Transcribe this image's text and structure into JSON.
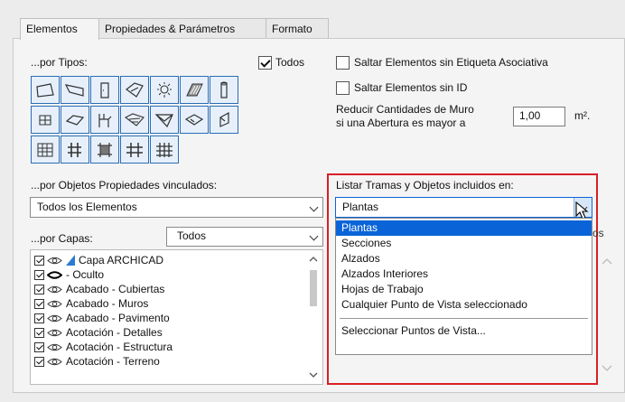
{
  "tabs": [
    "Elementos",
    "Propiedades & Parámetros",
    "Formato"
  ],
  "by_type": {
    "label": "...por Tipos:",
    "all_label": "Todos",
    "icons": [
      [
        "wall-icon",
        "beam-icon",
        "door-icon",
        "window-icon",
        "lamp-icon",
        "slab-hatch-icon",
        "column-icon"
      ],
      [
        "object-icon",
        "slab-icon",
        "stair-icon",
        "roof-icon",
        "shell-icon",
        "morph-icon",
        "curtain-wall-icon"
      ],
      [
        "mesh-icon",
        "railing-icon",
        "zone-icon",
        "grid-icon",
        "fill-icon"
      ]
    ]
  },
  "options": {
    "skip_no_label": "Saltar Elementos sin Etiqueta Asociativa",
    "skip_no_id": "Saltar Elementos sin ID",
    "reduce_label_1": "Reducir Cantidades de Muro",
    "reduce_label_2": "si una Abertura es mayor a",
    "reduce_value": "1,00",
    "reduce_unit": "m²."
  },
  "by_props": {
    "label": "...por Objetos Propiedades vinculados:",
    "value": "Todos los Elementos"
  },
  "by_layers": {
    "label": "...por Capas:",
    "value": "Todos",
    "items": [
      {
        "name": "Capa ARCHICAD",
        "hidden": false,
        "special": true
      },
      {
        "name": "- Oculto",
        "hidden": true,
        "special": false
      },
      {
        "name": "Acabado - Cubiertas",
        "hidden": false,
        "special": false
      },
      {
        "name": "Acabado - Muros",
        "hidden": false,
        "special": false
      },
      {
        "name": "Acabado - Pavimento",
        "hidden": false,
        "special": false
      },
      {
        "name": "Acotación - Detalles",
        "hidden": false,
        "special": false
      },
      {
        "name": "Acotación - Estructura",
        "hidden": false,
        "special": false
      },
      {
        "name": "Acotación - Terreno",
        "hidden": false,
        "special": false
      }
    ]
  },
  "list_in": {
    "label": "Listar Tramas y Objetos incluidos en:",
    "value": "Plantas",
    "options": [
      "Plantas",
      "Secciones",
      "Alzados",
      "Alzados Interiores",
      "Hojas de Trabajo",
      "Cualquier Punto de Vista seleccionado"
    ],
    "extra_option": "Seleccionar Puntos de Vista...",
    "peek_text": "os"
  },
  "colors": {
    "accent": "#0a64d8",
    "highlight_box": "#d81f26",
    "icon_border": "#2a6db5"
  }
}
